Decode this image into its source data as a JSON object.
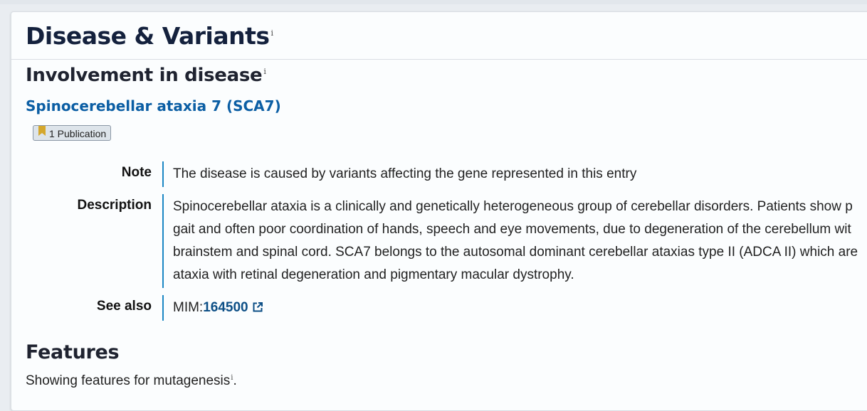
{
  "section": {
    "title": "Disease & Variants",
    "info_marker": "i"
  },
  "involvement": {
    "title": "Involvement in disease",
    "info_marker": "i",
    "disease_name": "Spinocerebellar ataxia 7 (SCA7)",
    "publication_badge": "1 Publication",
    "rows": {
      "note_label": "Note",
      "note_value": "The disease is caused by variants affecting the gene represented in this entry",
      "description_label": "Description",
      "description_lines": [
        "Spinocerebellar ataxia is a clinically and genetically heterogeneous group of cerebellar disorders. Patients show p",
        "gait and often poor coordination of hands, speech and eye movements, due to degeneration of the cerebellum wit",
        "brainstem and spinal cord. SCA7 belongs to the autosomal dominant cerebellar ataxias type II (ADCA II) which are",
        "ataxia with retinal degeneration and pigmentary macular dystrophy."
      ],
      "see_also_label": "See also",
      "see_also_prefix": "MIM:",
      "see_also_id": "164500"
    }
  },
  "features": {
    "title": "Features",
    "text": "Showing features for mutagenesis",
    "info_marker": "i",
    "trailing": "."
  },
  "icons": {
    "bookmark": "bookmark-icon",
    "external_link": "external-link-icon"
  },
  "colors": {
    "link": "#0b5ea4",
    "accent_bar": "#1b87c4",
    "bookmark": "#d4a72c"
  }
}
